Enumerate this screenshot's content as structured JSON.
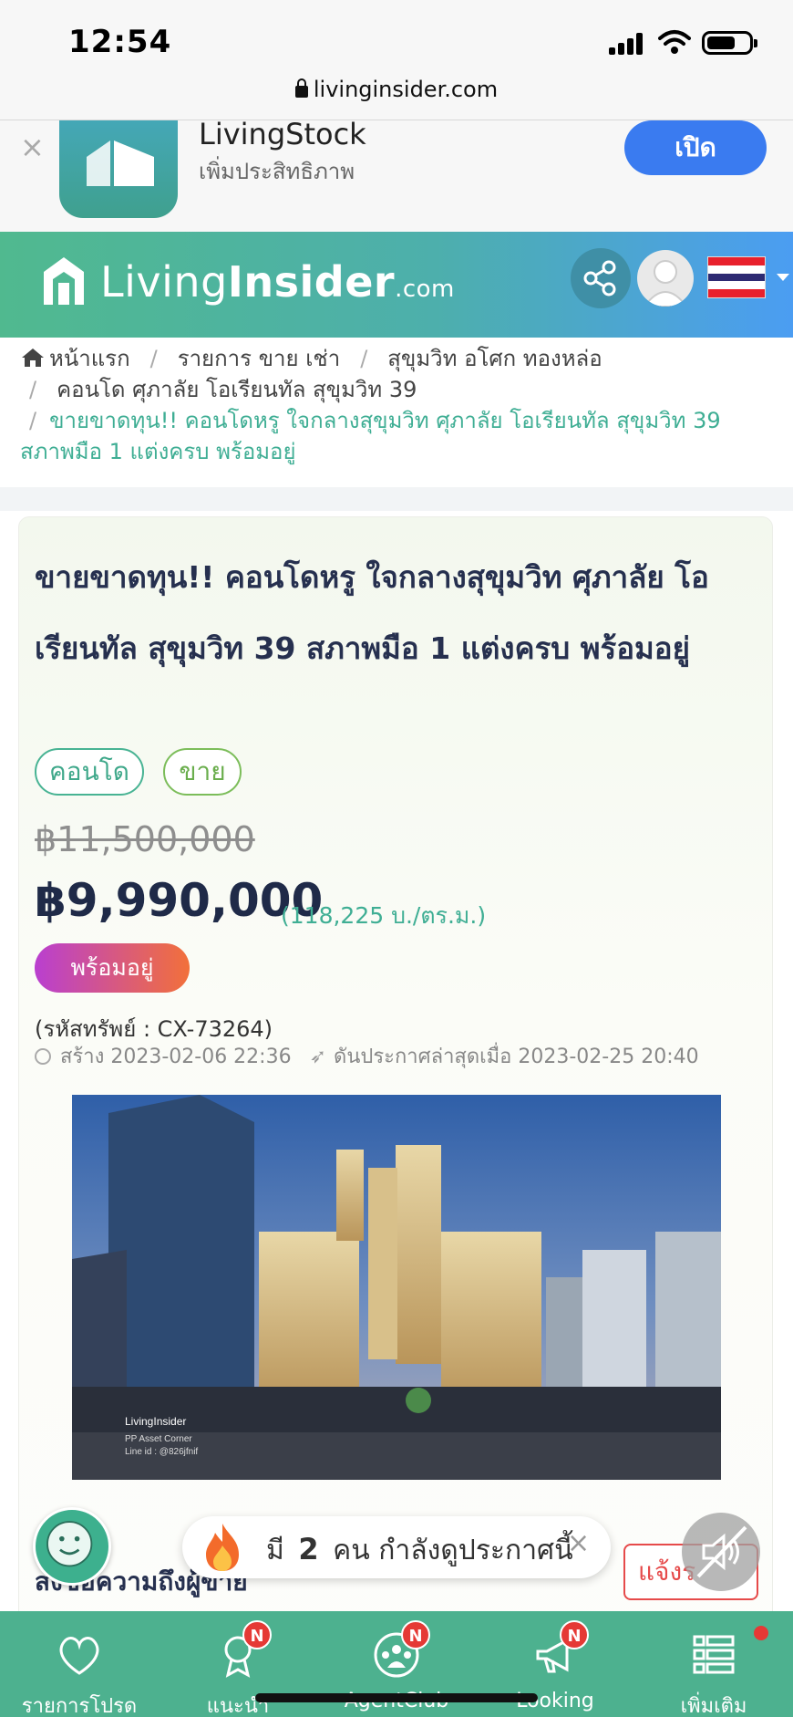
{
  "status_bar": {
    "time": "12:54"
  },
  "url_bar": {
    "domain": "livinginsider.com"
  },
  "app_banner": {
    "app_name": "LivingStock",
    "subtitle": "เพิ่มประสิทธิภาพ",
    "open_label": "เปิด",
    "close_glyph": "×"
  },
  "header": {
    "logo_living": "Living",
    "logo_insider": "Insider",
    "logo_dotcom": ".com",
    "flag": "thailand-flag"
  },
  "breadcrumb": {
    "home": "หน้าแรก",
    "items": [
      "รายการ ขาย เช่า",
      "สุขุมวิท อโศก ทองหล่อ",
      "คอนโด ศุภาลัย โอเรียนทัล สุขุมวิท 39",
      "ขายขาดทุน!! คอนโดหรู ใจกลางสุขุมวิท ศุภาลัย โอเรียนทัล สุขุมวิท 39 สภาพมือ 1 แต่งครบ พร้อมอยู่"
    ],
    "separator": "/"
  },
  "listing": {
    "title": "ขายขาดทุน!! คอนโดหรู ใจกลางสุขุมวิท ศุภาลัย โอเรียนทัล สุขุมวิท 39 สภาพมือ 1 แต่งครบ พร้อมอยู่",
    "tags": [
      "คอนโด",
      "ขาย"
    ],
    "old_price": "฿11,500,000",
    "price": "฿9,990,000",
    "price_per_sqm": "(118,225 บ./ตร.ม.)",
    "ready_badge": "พร้อมอยู่",
    "property_code": "(รหัสทรัพย์ : CX-73264)",
    "created": "สร้าง 2023-02-06 22:36",
    "boosted": "ดันประกาศล่าสุดเมื่อ 2023-02-25 20:40",
    "photo_watermark_brand": "LivingInsider",
    "photo_watermark_agent": "PP Asset Corner",
    "photo_watermark_line": "Line id : @826jfnif"
  },
  "overlays": {
    "chat_hint": "ส่งข้อความถึงผู้ขาย",
    "viewers_prefix": "มี",
    "viewers_count": "2",
    "viewers_suffix": "คน กำลังดูประกาศนี้",
    "viewers_close": "×",
    "report_label": "แจ้งร"
  },
  "bottom_nav": {
    "items": [
      {
        "label": "รายการโปรด",
        "icon": "heart-icon",
        "badge": ""
      },
      {
        "label": "แนะนำ",
        "icon": "award-icon",
        "badge": "N"
      },
      {
        "label": "AgentClub",
        "icon": "group-icon",
        "badge": "N"
      },
      {
        "label": "Looking",
        "icon": "megaphone-icon",
        "badge": "N"
      },
      {
        "label": "เพิ่มเติม",
        "icon": "menu-list-icon",
        "badge": ""
      }
    ]
  },
  "colors": {
    "brand_green": "#4db18f",
    "header_blue": "#4b9df2",
    "price_text": "#1f2a48",
    "accent_teal": "#3fae94",
    "badge_red": "#e53935"
  }
}
